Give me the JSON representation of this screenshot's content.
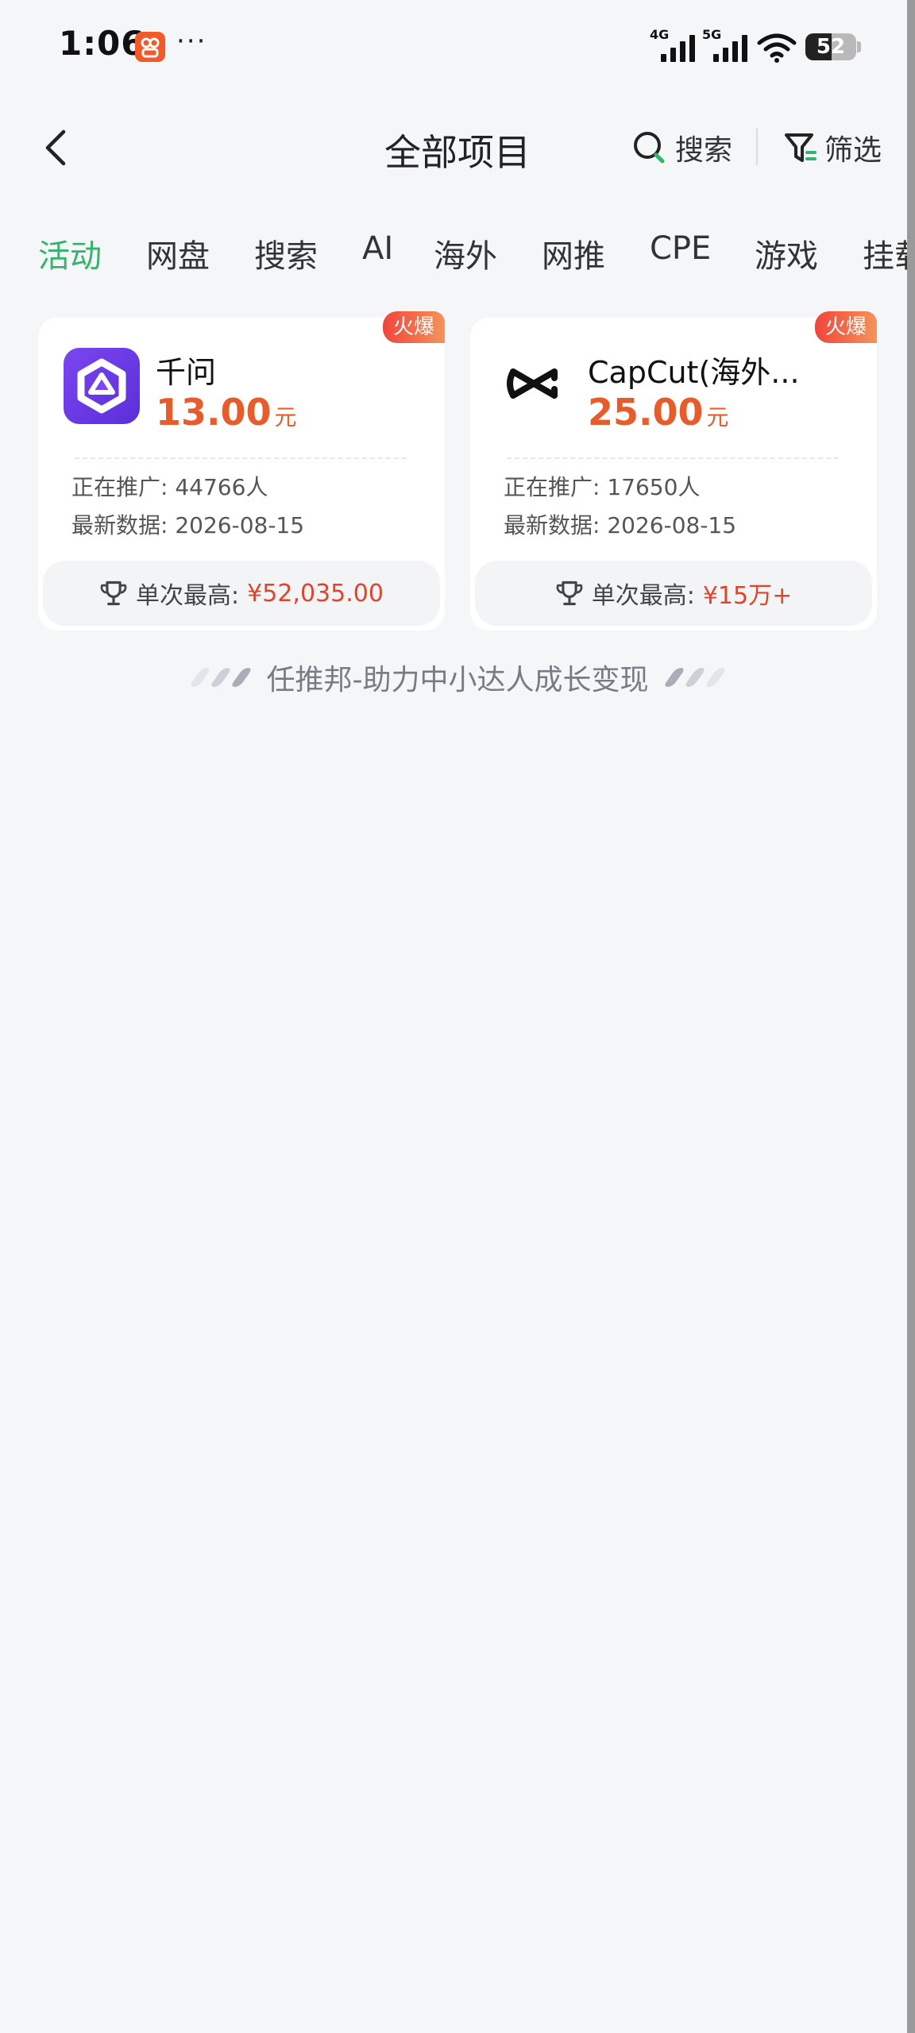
{
  "status_bar": {
    "time": "1:06",
    "dots": "···",
    "network_1": "4G",
    "network_2": "5G",
    "battery": "52",
    "battery_level": 0.52
  },
  "header": {
    "title": "全部项目",
    "search_label": "搜索",
    "filter_label": "筛选"
  },
  "tabs": [
    {
      "label": "活动",
      "active": true
    },
    {
      "label": "网盘",
      "active": false
    },
    {
      "label": "搜索",
      "active": false
    },
    {
      "label": "AI",
      "active": false
    },
    {
      "label": "海外",
      "active": false
    },
    {
      "label": "网推",
      "active": false
    },
    {
      "label": "CPE",
      "active": false
    },
    {
      "label": "游戏",
      "active": false
    },
    {
      "label": "挂载",
      "active": false
    }
  ],
  "cards": [
    {
      "badge": "火爆",
      "name": "千问",
      "price": "13.00",
      "unit": "元",
      "promoting": "正在推广: 44766人",
      "latest": "最新数据: 2026-08-15",
      "max_label": "单次最高:",
      "max_value": "¥52,035.00",
      "icon": "qianwen-icon"
    },
    {
      "badge": "火爆",
      "name": "CapCut(海外...",
      "price": "25.00",
      "unit": "元",
      "promoting": "正在推广: 17650人",
      "latest": "最新数据: 2026-08-15",
      "max_label": "单次最高:",
      "max_value": "¥15万+",
      "icon": "capcut-icon"
    }
  ],
  "tagline": "任推邦-助力中小达人成长变现",
  "colors": {
    "accent_green": "#35b36b",
    "price_orange": "#e85b2a",
    "max_red": "#e0442d",
    "badge_red": "#f2453b",
    "background": "#f5f6f8"
  }
}
